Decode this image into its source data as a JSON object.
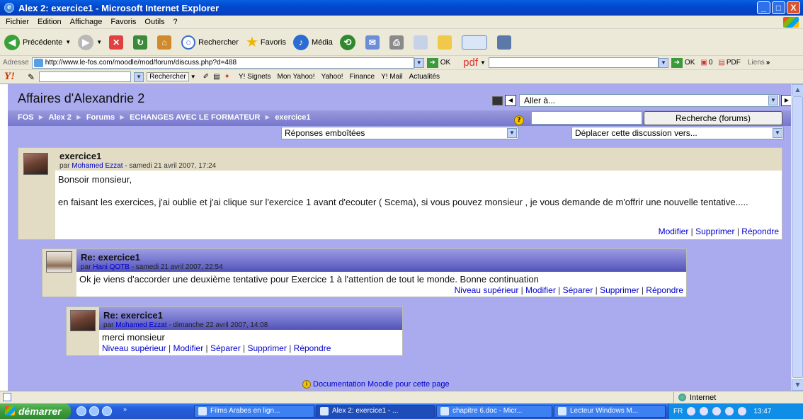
{
  "window": {
    "title": "Alex 2: exercice1 - Microsoft Internet Explorer",
    "buttons": [
      "_",
      "□",
      "X"
    ]
  },
  "menu": [
    "Fichier",
    "Edition",
    "Affichage",
    "Favoris",
    "Outils",
    "?"
  ],
  "toolbar": {
    "back": "Précédente",
    "search": "Rechercher",
    "favorites": "Favoris",
    "media": "Média"
  },
  "address": {
    "label": "Adresse",
    "url": "http://www.le-fos.com/moodle/mod/forum/discuss.php?d=488",
    "go": "OK",
    "pdf": "pdf",
    "ok2": "OK",
    "count": "0",
    "pdf2": "PDF",
    "links": "Liens"
  },
  "yahoo": {
    "logo": "Y!",
    "search": "Rechercher",
    "items": [
      "Y! Signets",
      "Mon Yahoo!",
      "Yahoo!",
      "Finance",
      "Y! Mail",
      "Actualités"
    ]
  },
  "page": {
    "course_title": "Affaires d'Alexandrie 2",
    "jump": "Aller à...",
    "breadcrumb": [
      "FOS",
      "Alex 2",
      "Forums",
      "ECHANGES AVEC LE FORMATEUR",
      "exercice1"
    ],
    "search_button": "Recherche (forums)",
    "display_mode": "Réponses emboîtées",
    "move_discussion": "Déplacer cette discussion vers...",
    "docs_link": "Documentation Moodle pour cette page"
  },
  "posts": [
    {
      "subject": "exercice1",
      "by": "par",
      "author": "Mohamed Ezzat",
      "date": " - samedi 21 avril 2007, 17:24",
      "body": [
        "Bonsoir monsieur,",
        "en faisant les exercices, j'ai oublie et j'ai clique sur l'exercice 1 avant d'ecouter ( Scema), si vous pouvez monsieur , je vous demande de m'offrir une nouvelle tentative....."
      ],
      "commands": [
        "Modifier",
        "Supprimer",
        "Répondre"
      ]
    },
    {
      "subject": "Re: exercice1",
      "by": "par",
      "author": "Hani QOTB",
      "date": " - samedi 21 avril 2007, 22:54",
      "body": [
        "Ok je viens d'accorder une deuxième tentative pour Exercice 1 à l'attention de tout le monde. Bonne continuation"
      ],
      "commands": [
        "Niveau supérieur",
        "Modifier",
        "Séparer",
        "Supprimer",
        "Répondre"
      ]
    },
    {
      "subject": "Re: exercice1",
      "by": "par",
      "author": "Mohamed Ezzat",
      "date": " - dimanche 22 avril 2007, 14:08",
      "body": [
        "merci monsieur"
      ],
      "commands": [
        "Niveau supérieur",
        "Modifier",
        "Séparer",
        "Supprimer",
        "Répondre"
      ]
    }
  ],
  "status": {
    "zone": "Internet"
  },
  "taskbar": {
    "start": "démarrer",
    "tasks": [
      "Films Arabes en lign...",
      "Alex 2: exercice1 - ...",
      "chapitre 6.doc - Micr...",
      "Lecteur Windows M..."
    ],
    "lang": "FR",
    "clock": "13:47"
  }
}
